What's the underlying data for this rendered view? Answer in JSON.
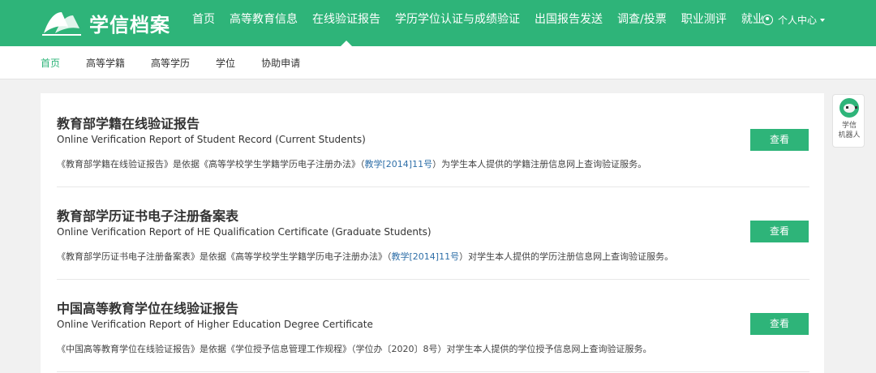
{
  "header": {
    "logo_text": "学信档案",
    "nav": [
      "首页",
      "高等教育信息",
      "在线验证报告",
      "学历学位认证与成绩验证",
      "出国报告发送",
      "调查/投票",
      "职业测评",
      "就业"
    ],
    "user_center": "个人中心"
  },
  "subnav": [
    "首页",
    "高等学籍",
    "高等学历",
    "学位",
    "协助申请"
  ],
  "reports": [
    {
      "title": "教育部学籍在线验证报告",
      "en": "Online Verification Report of Student Record (Current Students)",
      "desc_a": "《教育部学籍在线验证报告》是依据《高等学校学生学籍学历电子注册办法》（",
      "desc_link": "教学[2014]11号",
      "desc_b": "）为学生本人提供的学籍注册信息网上查询验证服务。",
      "button": "查看"
    },
    {
      "title": "教育部学历证书电子注册备案表",
      "en": "Online Verification Report of HE Qualification Certificate (Graduate Students)",
      "desc_a": "《教育部学历证书电子注册备案表》是依据《高等学校学生学籍学历电子注册办法》（",
      "desc_link": "教学[2014]11号",
      "desc_b": "）对学生本人提供的学历注册信息网上查询验证服务。",
      "button": "查看"
    },
    {
      "title": "中国高等教育学位在线验证报告",
      "en": "Online Verification Report of Higher Education Degree Certificate",
      "desc_a": "《中国高等教育学位在线验证报告》是依据《学位授予信息管理工作规程》（学位办〔2020〕8号）对学生本人提供的学位授予信息网上查询验证服务。",
      "desc_link": "",
      "desc_b": "",
      "button": "查看"
    }
  ],
  "robot": {
    "line1": "学信",
    "line2": "机器人"
  },
  "colors": {
    "brand": "#2eb479",
    "link": "#2f6fa8"
  }
}
